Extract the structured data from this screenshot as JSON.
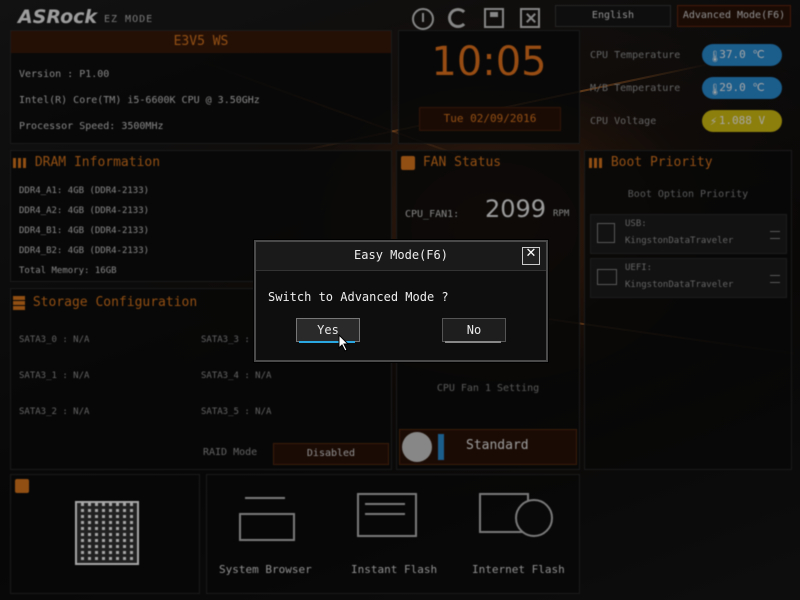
{
  "brand": {
    "logo": "ASRock",
    "mode": "EZ MODE"
  },
  "top_bar": {
    "language": "English",
    "advanced_mode": "Advanced Mode(F6)"
  },
  "system": {
    "board_name": "E3V5 WS",
    "version": "Version : P1.00",
    "cpu": "Intel(R) Core(TM) i5-6600K CPU @ 3.50GHz",
    "speed": "Processor Speed: 3500MHz"
  },
  "clock": {
    "time": "10:05",
    "date": "Tue 02/09/2016"
  },
  "monitor": [
    {
      "label": "CPU Temperature",
      "value": "37.0 ℃",
      "color": "#2a8fd6"
    },
    {
      "label": "M/B Temperature",
      "value": "29.0 ℃",
      "color": "#2a8fd6"
    },
    {
      "label": "CPU Voltage",
      "value": "1.088 V",
      "color": "#d8c313"
    }
  ],
  "dram": {
    "title": "DRAM Information",
    "slots": [
      {
        "name": "DDR4_A1:",
        "value": "4GB (DDR4-2133)"
      },
      {
        "name": "DDR4_A2:",
        "value": "4GB (DDR4-2133)"
      },
      {
        "name": "DDR4_B1:",
        "value": "4GB (DDR4-2133)"
      },
      {
        "name": "DDR4_B2:",
        "value": "4GB (DDR4-2133)"
      }
    ],
    "total": "Total Memory: 16GB"
  },
  "fan": {
    "title": "FAN Status",
    "name": "CPU_FAN1:",
    "rpm": "2099",
    "unit": "RPM",
    "setting_label": "CPU Fan 1 Setting",
    "mode": "Standard"
  },
  "boot": {
    "title": "Boot Priority",
    "subtitle": "Boot Option Priority",
    "items": [
      {
        "type": "USB:",
        "device": "KingstonDataTraveler"
      },
      {
        "type": "UEFI:",
        "device": "KingstonDataTraveler"
      }
    ]
  },
  "storage": {
    "title": "Storage Configuration",
    "ports": [
      "SATA3_0 : N/A",
      "SATA3_1 : N/A",
      "SATA3_2 : N/A",
      "SATA3_3 : N/A",
      "SATA3_4 : N/A",
      "SATA3_5 : N/A"
    ],
    "raid_label": "RAID Mode",
    "raid_value": "Disabled"
  },
  "tools": [
    "System Browser",
    "Instant Flash",
    "Internet Flash"
  ],
  "dialog": {
    "title": "Easy Mode(F6)",
    "message": "Switch to Advanced Mode ?",
    "yes": "Yes",
    "no": "No"
  }
}
